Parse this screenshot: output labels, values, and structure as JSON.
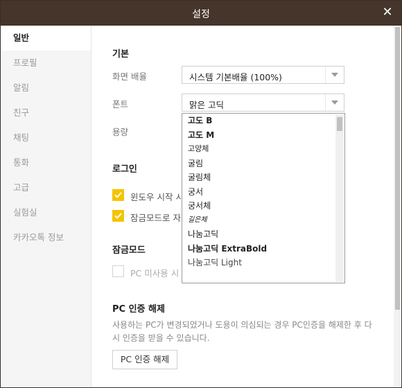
{
  "window": {
    "title": "설정",
    "close_glyph": "✕"
  },
  "sidebar": {
    "items": [
      {
        "label": "일반",
        "active": true
      },
      {
        "label": "프로필"
      },
      {
        "label": "알림"
      },
      {
        "label": "친구"
      },
      {
        "label": "채팅"
      },
      {
        "label": "통화"
      },
      {
        "label": "고급"
      },
      {
        "label": "실험실"
      },
      {
        "label": "카카오톡 정보"
      }
    ]
  },
  "general": {
    "section_basic": "기본",
    "screen_zoom_label": "화면 배율",
    "screen_zoom_value": "시스템 기본배율 (100%)",
    "font_label": "폰트",
    "font_value": "맑은 고딕",
    "volume_label": "용량",
    "section_login": "로그인",
    "login_option_1": "윈도우 시작 시",
    "login_option_2": "잠금모드로 자",
    "section_lock": "잠금모드",
    "lock_option_1": "PC 미사용 시",
    "section_pc_auth": "PC 인증 해제",
    "pc_auth_desc": "사용하는 PC가 변경되었거나 도용이 의심되는 경우 PC인증을 해제한 후 다시 인증을 받을 수 있습니다.",
    "pc_auth_button": "PC 인증 해제"
  },
  "font_dropdown": {
    "options": [
      {
        "label": "고도 B",
        "bold": true
      },
      {
        "label": "고도 M",
        "bold": true
      },
      {
        "label": "고양체"
      },
      {
        "label": "굴림"
      },
      {
        "label": "굴림체"
      },
      {
        "label": "궁서"
      },
      {
        "label": "궁서체"
      },
      {
        "label": "길은체"
      },
      {
        "label": "나눔고딕"
      },
      {
        "label": "나눔고딕 ExtraBold",
        "bold": true
      },
      {
        "label": "나눔고딕 Light"
      }
    ]
  },
  "colors": {
    "titlebar": "#45352b",
    "checkbox_accent": "#f4c400"
  }
}
